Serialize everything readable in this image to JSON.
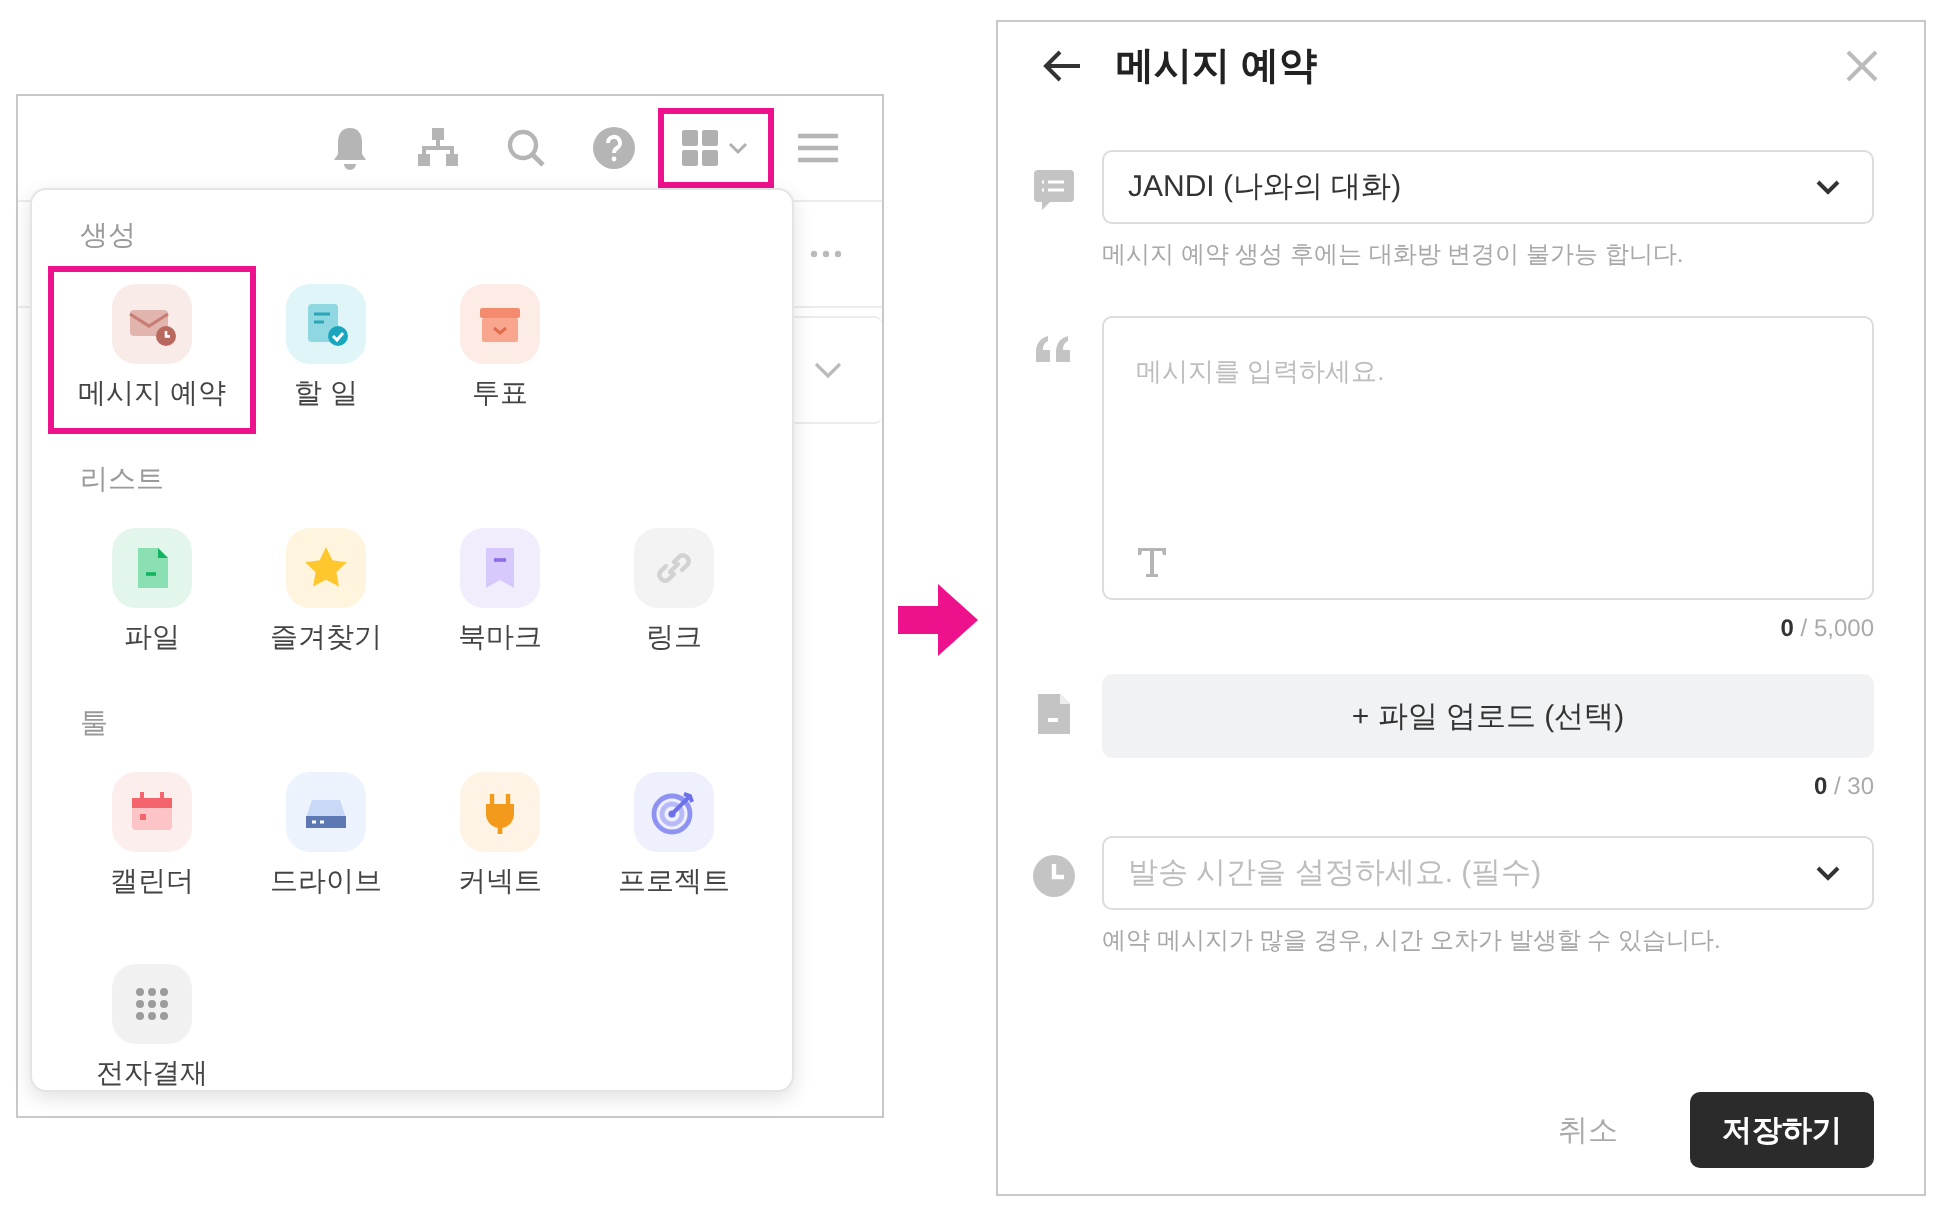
{
  "left_panel": {
    "toolbar": [
      {
        "kind": "bell",
        "highlighted": false
      },
      {
        "kind": "org-chart",
        "highlighted": false
      },
      {
        "kind": "search",
        "highlighted": false
      },
      {
        "kind": "help",
        "highlighted": false
      },
      {
        "kind": "apps",
        "highlighted": true
      },
      {
        "kind": "menu",
        "highlighted": false
      }
    ],
    "menu": {
      "sections": [
        {
          "label": "생성",
          "items": [
            {
              "kind": "message-schedule",
              "label": "메시지 예약",
              "highlighted": true
            },
            {
              "kind": "todo",
              "label": "할 일",
              "highlighted": false
            },
            {
              "kind": "poll",
              "label": "투표",
              "highlighted": false
            }
          ]
        },
        {
          "label": "리스트",
          "items": [
            {
              "kind": "file",
              "label": "파일",
              "highlighted": false
            },
            {
              "kind": "star",
              "label": "즐겨찾기",
              "highlighted": false
            },
            {
              "kind": "bookmark",
              "label": "북마크",
              "highlighted": false
            },
            {
              "kind": "link",
              "label": "링크",
              "highlighted": false
            }
          ]
        },
        {
          "label": "툴",
          "items": [
            {
              "kind": "calendar",
              "label": "캘린더",
              "highlighted": false
            },
            {
              "kind": "drive",
              "label": "드라이브",
              "highlighted": false
            },
            {
              "kind": "connect",
              "label": "커넥트",
              "highlighted": false
            },
            {
              "kind": "project",
              "label": "프로젝트",
              "highlighted": false
            },
            {
              "kind": "approval",
              "label": "전자결재",
              "highlighted": false
            }
          ]
        }
      ]
    }
  },
  "right_panel": {
    "title": "메시지 예약",
    "channel_select": {
      "value": "JANDI (나와의 대화)",
      "hint": "메시지 예약 생성 후에는 대화방 변경이 불가능 합니다."
    },
    "message_field": {
      "placeholder": "메시지를 입력하세요.",
      "counter": "**0** / 5,000"
    },
    "file_upload": {
      "label": "+ 파일 업로드 (선택)",
      "counter": "**0** / 30"
    },
    "time_select": {
      "placeholder": "발송 시간을 설정하세요. (필수)",
      "hint": "예약 메시지가 많을 경우, 시간 오차가 발생할 수 있습니다."
    },
    "buttons": [
      {
        "kind": "secondary",
        "label": "취소"
      },
      {
        "kind": "primary",
        "label": "저장하기"
      }
    ]
  }
}
